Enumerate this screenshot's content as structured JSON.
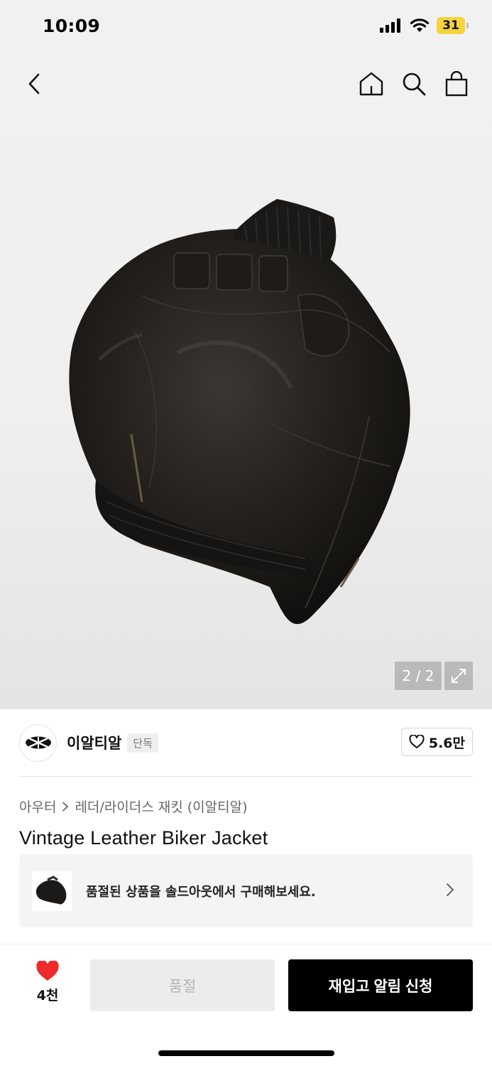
{
  "status_bar": {
    "time": "10:09",
    "battery": "31",
    "icons": [
      "cellular-signal-icon",
      "wifi-icon",
      "battery-icon"
    ]
  },
  "nav": {
    "icons": [
      "back-chevron-icon",
      "home-icon",
      "search-icon",
      "shopping-bag-icon"
    ]
  },
  "gallery": {
    "counter": "2 / 2",
    "expand_icon": "expand-icon"
  },
  "brand": {
    "name": "이알티알",
    "tag": "단독",
    "likes": "5.6만"
  },
  "breadcrumb": {
    "category": "아우터",
    "separator_icon": "chevron-right-icon",
    "subcategory": "레더/라이더스 재킷 (이알티알)"
  },
  "product": {
    "title": "Vintage Leather Biker Jacket"
  },
  "soldout_banner": {
    "text": "품절된 상품을 솔드아웃에서 구매해보세요."
  },
  "bottom_bar": {
    "favorite_count": "4천",
    "soldout_label": "품절",
    "restock_label": "재입고 알림 신청",
    "heart_color": "#ee2b2b"
  }
}
